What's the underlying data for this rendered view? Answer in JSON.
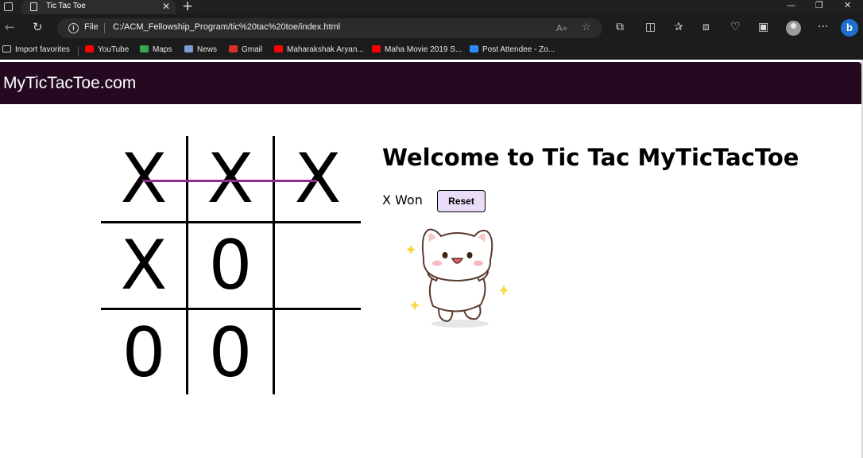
{
  "browser": {
    "tab": {
      "title": "Tic Tac Toe",
      "close": "✕"
    },
    "window_controls": {
      "minimize": "—",
      "restore": "❐",
      "close": "✕"
    },
    "address": {
      "scheme_label": "File",
      "url": "C:/ACM_Fellowship_Program/tic%20tac%20toe/index.html"
    },
    "bookmarks": [
      {
        "label": "Import favorites",
        "icon": "import-icon",
        "color": "#c8c8c8"
      },
      {
        "label": "YouTube",
        "icon": "youtube-icon",
        "color": "#ff0000"
      },
      {
        "label": "Maps",
        "icon": "maps-icon",
        "color": "#34a853"
      },
      {
        "label": "News",
        "icon": "news-icon",
        "color": "#7a9cd6"
      },
      {
        "label": "Gmail",
        "icon": "gmail-icon",
        "color": "#d93025"
      },
      {
        "label": "Maharakshak Aryan...",
        "icon": "youtube-icon",
        "color": "#ff0000"
      },
      {
        "label": "Maha Movie 2019 S...",
        "icon": "youtube-icon",
        "color": "#ff0000"
      },
      {
        "label": "Post Attendee - Zo...",
        "icon": "zoom-icon",
        "color": "#2d8cff"
      }
    ]
  },
  "site": {
    "title": "MyTicTacToe.com",
    "header_color": "#240921"
  },
  "game": {
    "board": [
      "X",
      "X",
      "X",
      "X",
      "0",
      "",
      "0",
      "0",
      ""
    ],
    "win_line": "top-row",
    "win_line_color": "#8e2e8f",
    "heading": "Welcome to Tic Tac MyTicTacToe",
    "status": "X Won",
    "reset_label": "Reset",
    "reset_color": "#e9dcf7",
    "image": "happy-cat-illustration"
  }
}
